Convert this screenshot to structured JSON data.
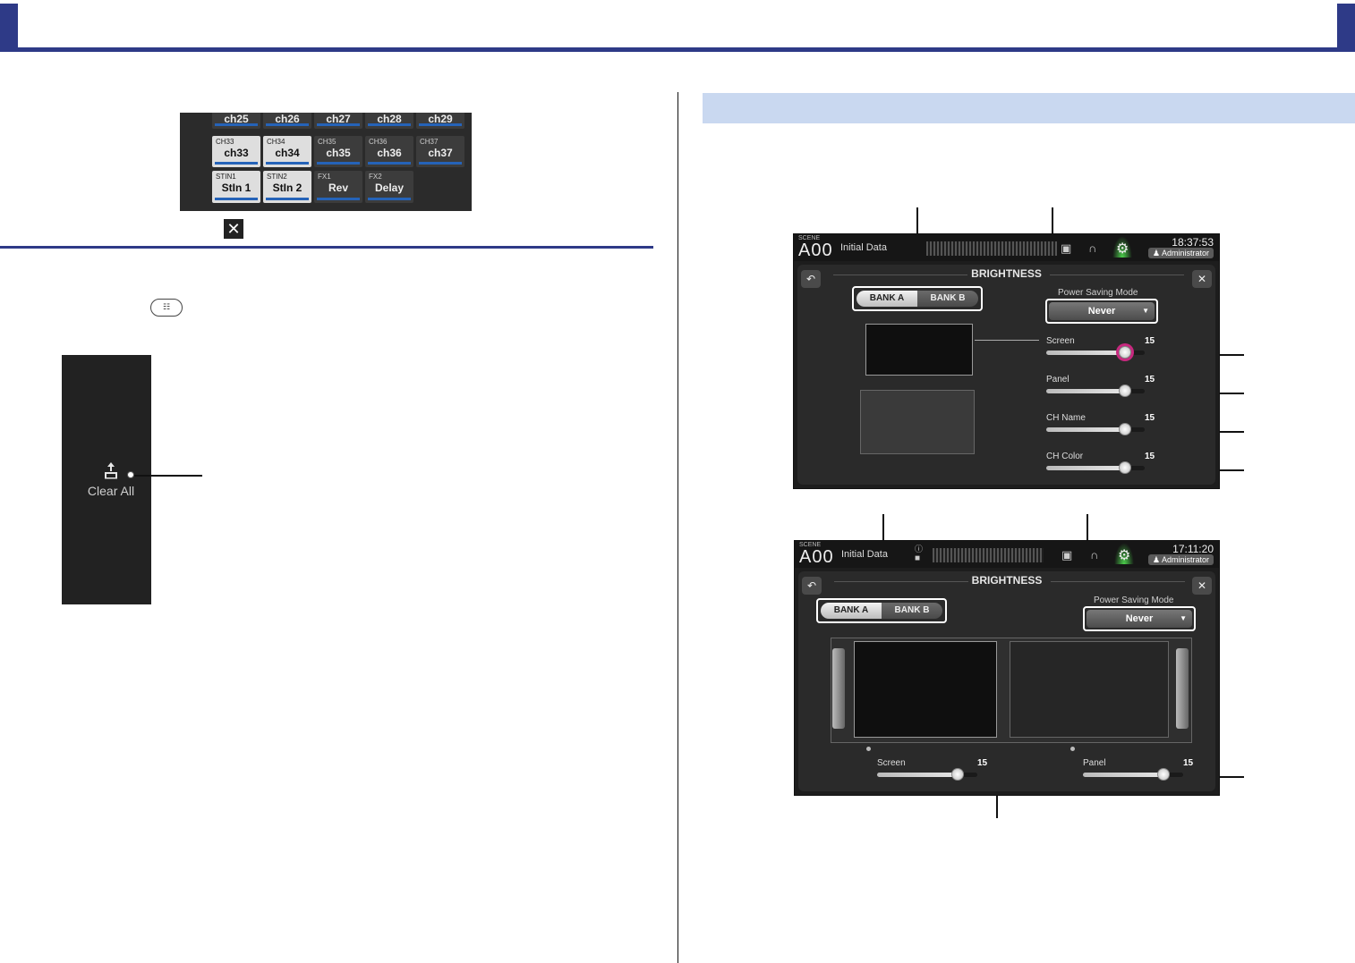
{
  "channel_grid": {
    "rows": [
      [
        {
          "tag": "",
          "name": "ch25",
          "style": "dark"
        },
        {
          "tag": "",
          "name": "ch26",
          "style": "dark"
        },
        {
          "tag": "",
          "name": "ch27",
          "style": "dark"
        },
        {
          "tag": "",
          "name": "ch28",
          "style": "dark"
        },
        {
          "tag": "",
          "name": "ch29",
          "style": "dark"
        }
      ],
      [
        {
          "tag": "CH33",
          "name": "ch33",
          "style": "lite"
        },
        {
          "tag": "CH34",
          "name": "ch34",
          "style": "lite"
        },
        {
          "tag": "CH35",
          "name": "ch35",
          "style": "dark"
        },
        {
          "tag": "CH36",
          "name": "ch36",
          "style": "dark"
        },
        {
          "tag": "CH37",
          "name": "ch37",
          "style": "dark"
        }
      ],
      [
        {
          "tag": "STIN1",
          "name": "StIn 1",
          "style": "lite"
        },
        {
          "tag": "STIN2",
          "name": "StIn 2",
          "style": "lite"
        },
        {
          "tag": "FX1",
          "name": "Rev",
          "style": "dark"
        },
        {
          "tag": "FX2",
          "name": "Delay",
          "style": "dark"
        }
      ]
    ]
  },
  "menu_panel": {
    "clear_all_label": "Clear All"
  },
  "icons": {
    "close": "close-icon",
    "menu": "menu-icon",
    "clear_all": "clear-all-icon"
  },
  "screen1": {
    "scene_caption": "SCENE",
    "scene_id": "A00",
    "scene_name": "Initial Data",
    "time": "18:37:53",
    "user": "Administrator",
    "dialog_title": "BRIGHTNESS",
    "bank_a": "BANK A",
    "bank_b": "BANK B",
    "power_saving_label": "Power Saving Mode",
    "power_saving_value": "Never",
    "sliders": [
      {
        "label": "Screen",
        "value": "15",
        "level": 0.8
      },
      {
        "label": "Panel",
        "value": "15",
        "level": 0.8
      },
      {
        "label": "CH Name",
        "value": "15",
        "level": 0.8
      },
      {
        "label": "CH Color",
        "value": "15",
        "level": 0.8
      }
    ]
  },
  "screen2": {
    "scene_caption": "SCENE",
    "scene_id": "A00",
    "scene_name": "Initial Data",
    "time": "17:11:20",
    "user": "Administrator",
    "dialog_title": "BRIGHTNESS",
    "bank_a": "BANK A",
    "bank_b": "BANK B",
    "power_saving_label": "Power Saving Mode",
    "power_saving_value": "Never",
    "sliders": [
      {
        "label": "Screen",
        "value": "15",
        "level": 0.8
      },
      {
        "label": "Panel",
        "value": "15",
        "level": 0.8
      }
    ]
  },
  "colors": {
    "brand_blue": "#2e3a87",
    "section_band": "#c9d8f0",
    "highlight": "#c8287f"
  }
}
